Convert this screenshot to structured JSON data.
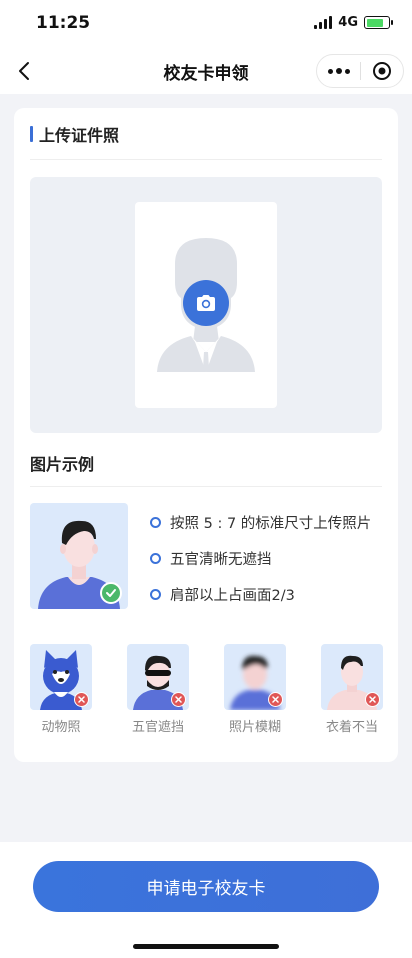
{
  "status_bar": {
    "time": "11:25",
    "network": "4G",
    "battery_level": 0.8
  },
  "nav": {
    "title": "校友卡申领"
  },
  "upload": {
    "section_title": "上传证件照"
  },
  "example": {
    "title": "图片示例",
    "requirements": [
      "按照 5 : 7 的标准尺寸上传照片",
      "五官清晰无遮挡",
      "肩部以上占画面2/3"
    ],
    "bad_examples": [
      {
        "label": "动物照"
      },
      {
        "label": "五官遮挡"
      },
      {
        "label": "照片模糊"
      },
      {
        "label": "衣着不当"
      }
    ]
  },
  "footer": {
    "apply_label": "申请电子校友卡"
  },
  "colors": {
    "accent": "#3b72d9",
    "ok": "#4bb86a",
    "error": "#e05757",
    "page_bg": "#f2f3f7"
  }
}
